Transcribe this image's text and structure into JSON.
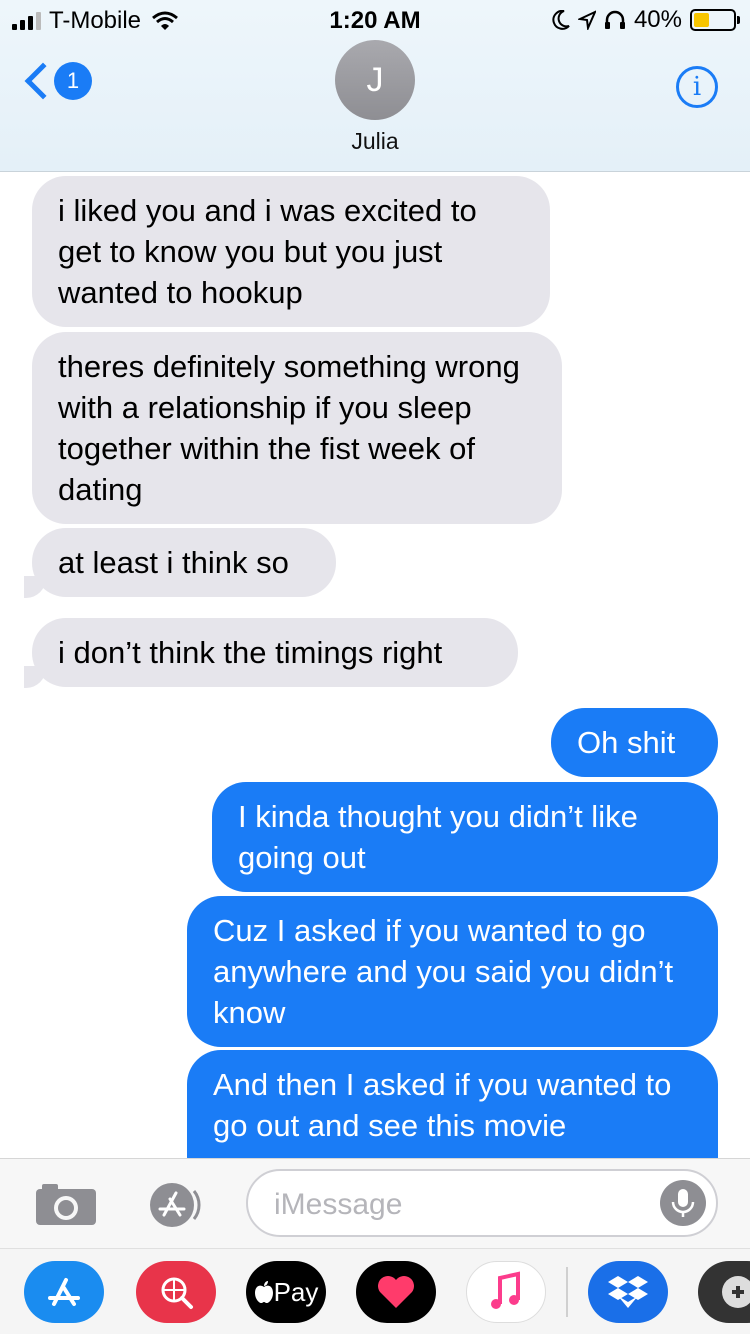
{
  "status_bar": {
    "carrier": "T-Mobile",
    "time": "1:20 AM",
    "battery": "40%",
    "battery_level": 0.4
  },
  "header": {
    "back_badge": "1",
    "avatar_initial": "J",
    "contact_name": "Julia",
    "info_label": "i"
  },
  "messages": [
    {
      "from": "them",
      "text": "i liked you and i was excited to get to know you but you just wanted to hookup"
    },
    {
      "from": "them",
      "text": "theres definitely something wrong with a relationship if you sleep together within the fist week of dating"
    },
    {
      "from": "them",
      "text": "at least i think so"
    },
    {
      "from": "them",
      "text": "i don’t think the timings right"
    },
    {
      "from": "me",
      "text": "Oh shit"
    },
    {
      "from": "me",
      "text": "I kinda thought you didn’t like going out"
    },
    {
      "from": "me",
      "text": "Cuz I asked if you wanted to go anywhere and you said you didn’t know"
    },
    {
      "from": "me",
      "text": "And then I asked if you wanted to go out and see this movie"
    }
  ],
  "input": {
    "placeholder": "iMessage"
  },
  "drawer": {
    "apple_pay_label": "Pay"
  },
  "icons": [
    "camera-icon",
    "app-store-icon",
    "mic-icon",
    "globe-search-icon",
    "apple-pay-icon",
    "heart-icon",
    "music-icon",
    "dropbox-icon",
    "game-icon"
  ],
  "colors": {
    "accent": "#1a7cf6",
    "incoming": "#e6e5eb",
    "outgoing": "#1a7cf6"
  }
}
